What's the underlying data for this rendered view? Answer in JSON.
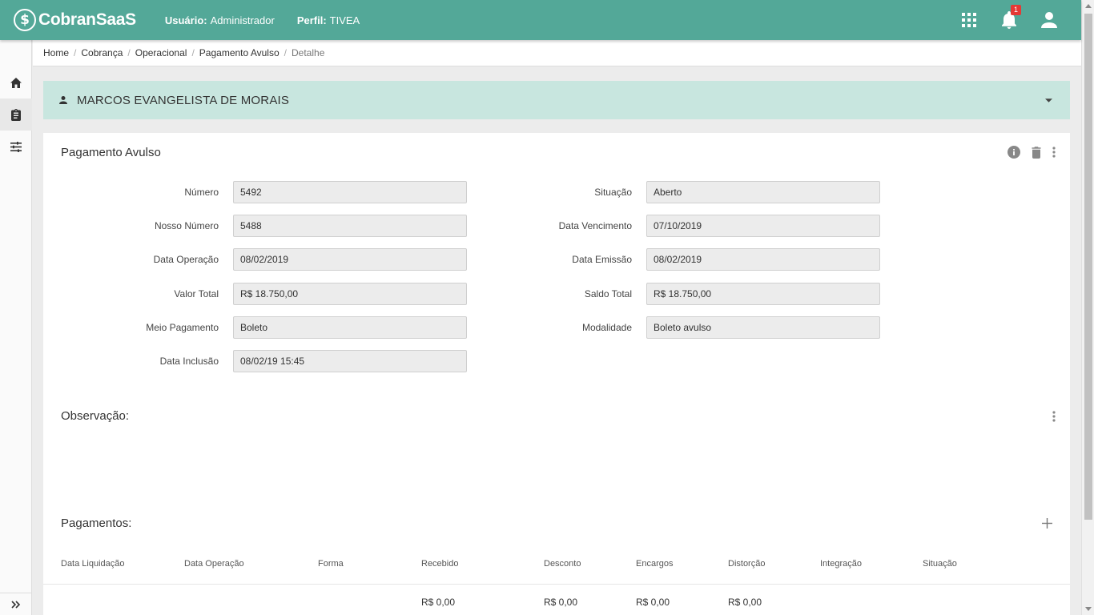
{
  "header": {
    "logo_text": "CobranSaaS",
    "user_label": "Usuário:",
    "user_value": "Administrador",
    "profile_label": "Perfil:",
    "profile_value": "TIVEA",
    "notification_count": "1"
  },
  "breadcrumb": [
    "Home",
    "Cobrança",
    "Operacional",
    "Pagamento Avulso",
    "Detalhe"
  ],
  "person": {
    "name": "MARCOS EVANGELISTA DE MORAIS"
  },
  "card": {
    "title": "Pagamento Avulso",
    "fields_left": [
      {
        "label": "Número",
        "value": "5492"
      },
      {
        "label": "Nosso Número",
        "value": "5488"
      },
      {
        "label": "Data Operação",
        "value": "08/02/2019"
      },
      {
        "label": "Valor Total",
        "value": "R$ 18.750,00"
      },
      {
        "label": "Meio Pagamento",
        "value": "Boleto"
      },
      {
        "label": "Data Inclusão",
        "value": "08/02/19 15:45"
      }
    ],
    "fields_right": [
      {
        "label": "Situação",
        "value": "Aberto"
      },
      {
        "label": "Data Vencimento",
        "value": "07/10/2019"
      },
      {
        "label": "Data Emissão",
        "value": "08/02/2019"
      },
      {
        "label": "Saldo Total",
        "value": "R$ 18.750,00"
      },
      {
        "label": "Modalidade",
        "value": "Boleto avulso"
      }
    ]
  },
  "observacao": {
    "title": "Observação:"
  },
  "pagamentos": {
    "title": "Pagamentos:",
    "columns": [
      "Data Liquidação",
      "Data Operação",
      "Forma",
      "Recebido",
      "Desconto",
      "Encargos",
      "Distorção",
      "Integração",
      "Situação"
    ],
    "totals": {
      "recebido": "R$ 0,00",
      "desconto": "R$ 0,00",
      "encargos": "R$ 0,00",
      "distorcao": "R$ 0,00"
    }
  },
  "colors": {
    "primary": "#53a898",
    "person_bg": "#c8e6df",
    "badge": "#e53935"
  }
}
